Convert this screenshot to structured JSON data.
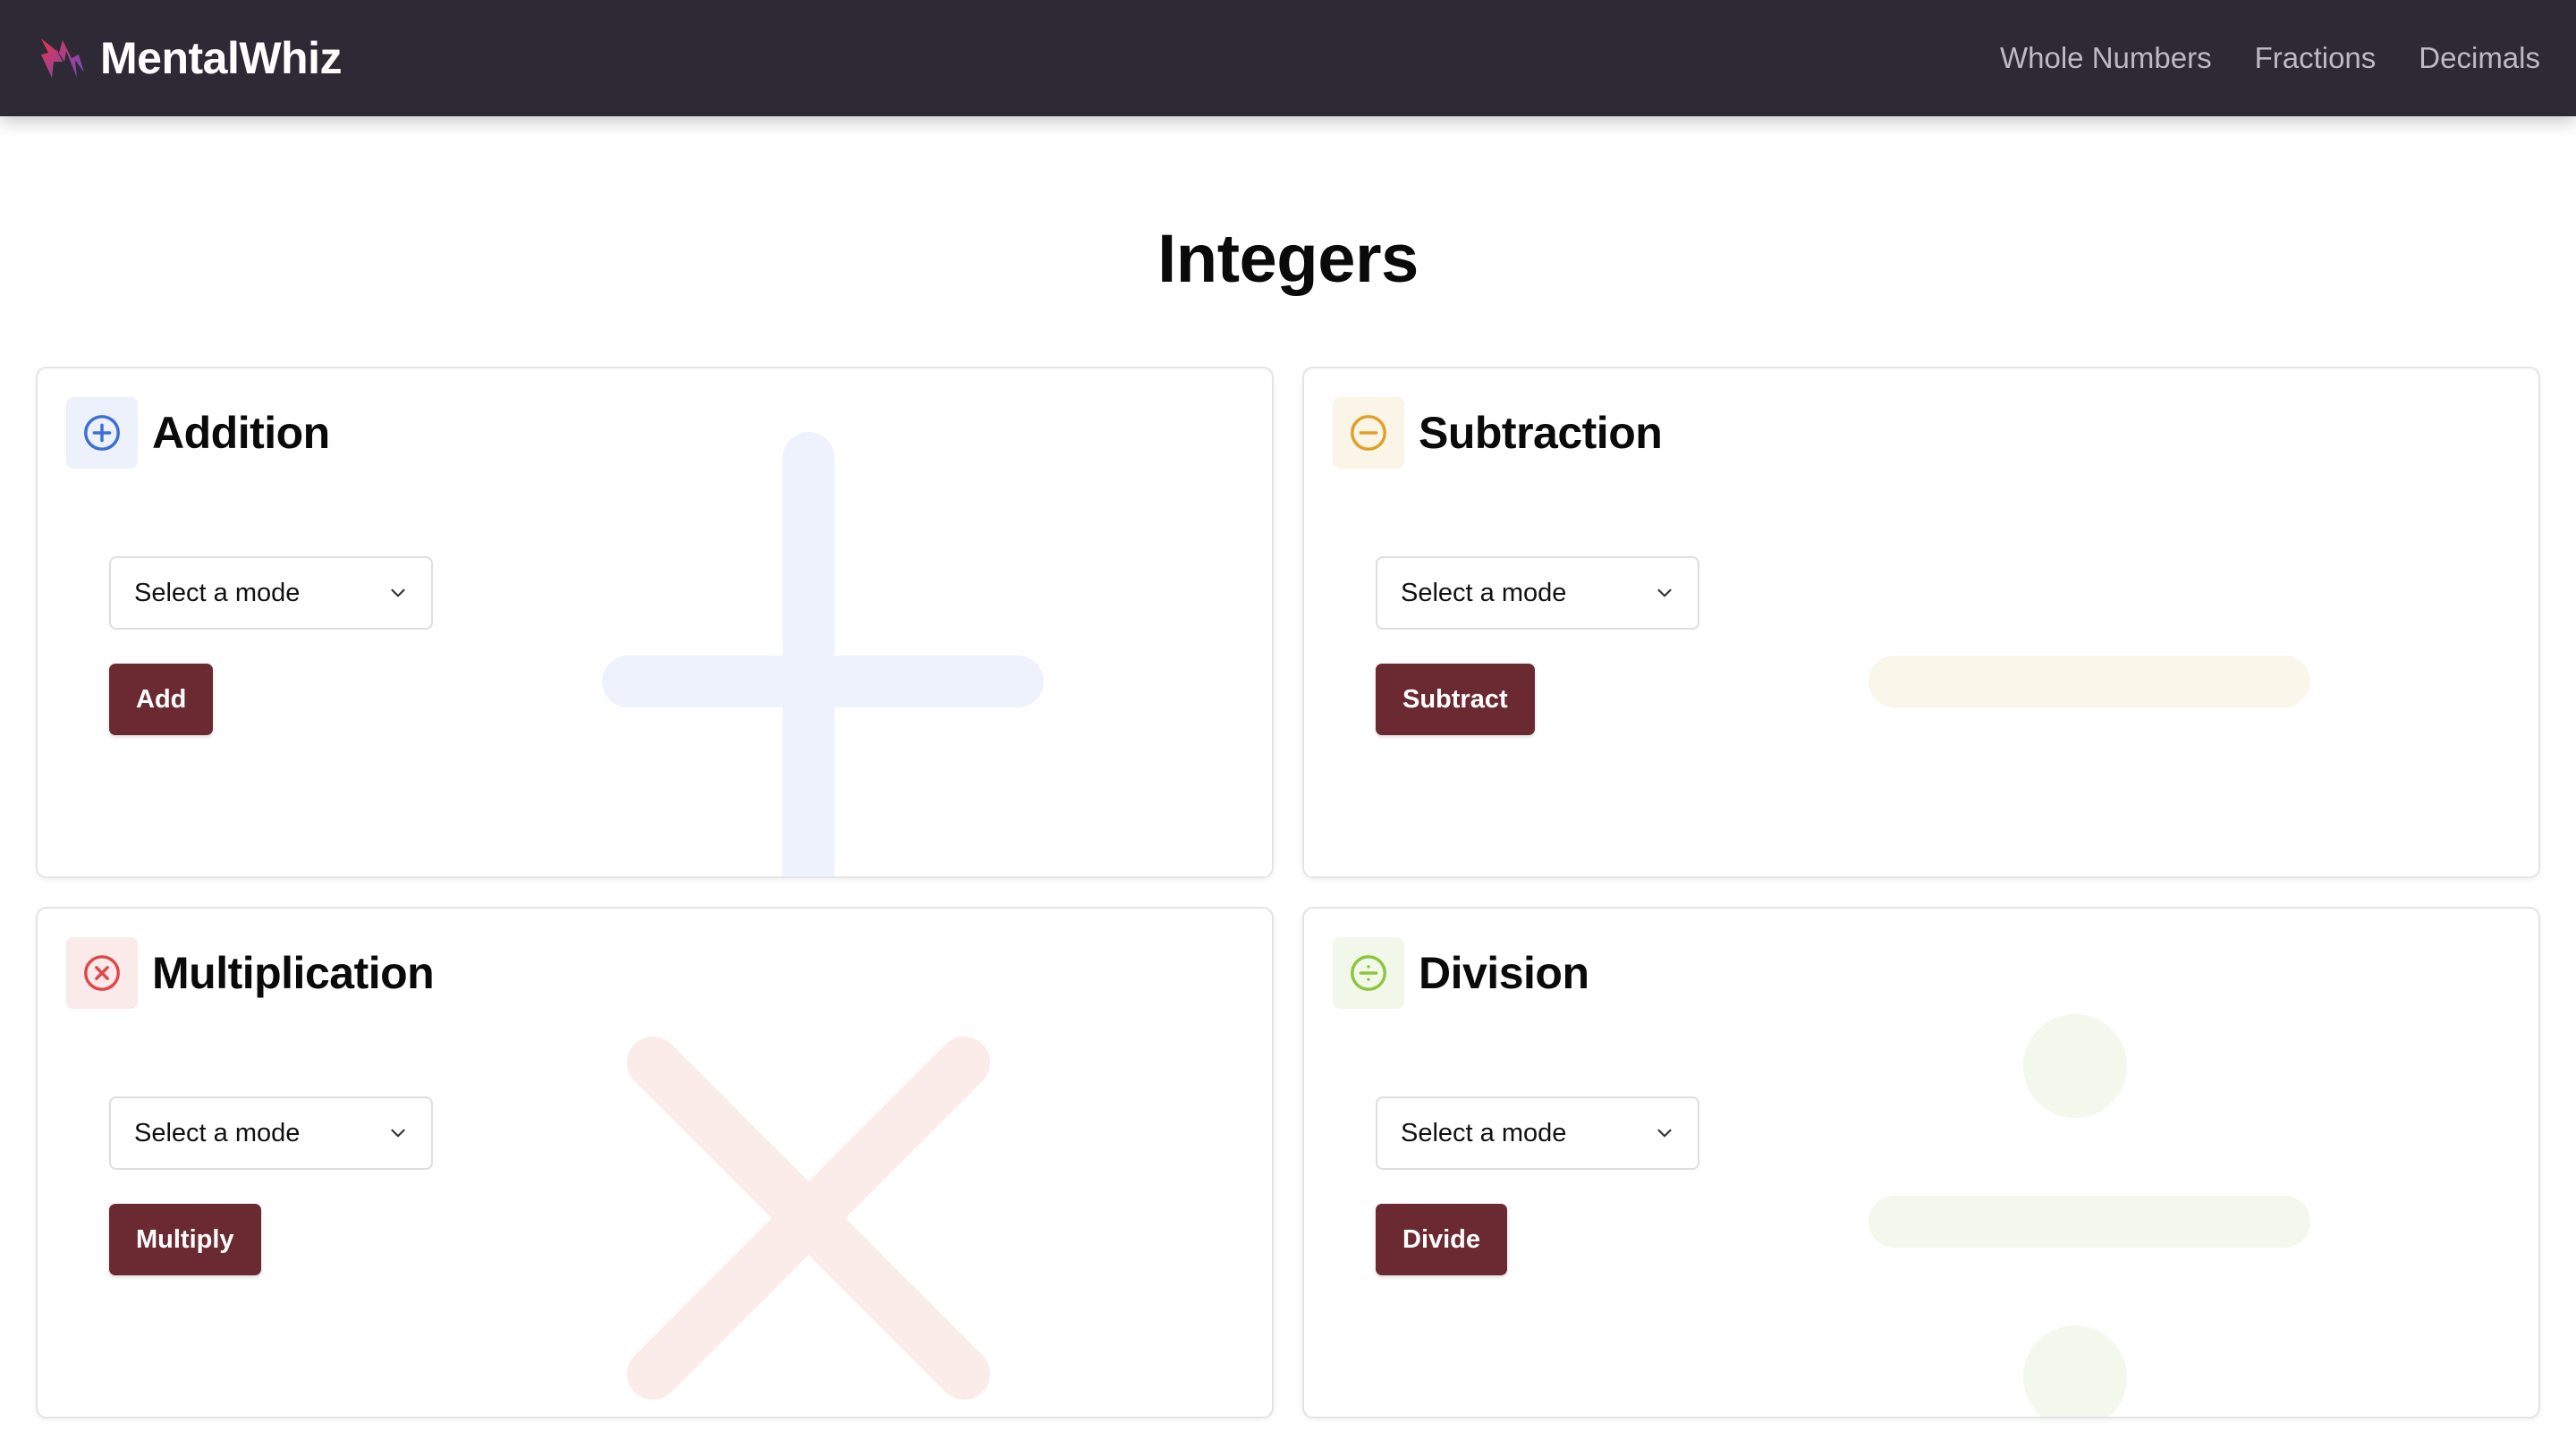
{
  "brand": {
    "name": "MentalWhiz",
    "logo_icon": "lightning-logo-icon"
  },
  "nav": {
    "links": [
      {
        "label": "Whole Numbers"
      },
      {
        "label": "Fractions"
      },
      {
        "label": "Decimals"
      }
    ]
  },
  "page": {
    "title": "Integers"
  },
  "cards": [
    {
      "id": "addition",
      "title": "Addition",
      "icon": "plus-circle-icon",
      "accent": "#3b6fd6",
      "icon_bg": "#edf1fb",
      "watermark": "plus",
      "watermark_color": "#eef2fc",
      "select_placeholder": "Select a mode",
      "button_label": "Add"
    },
    {
      "id": "subtraction",
      "title": "Subtraction",
      "icon": "minus-circle-icon",
      "accent": "#e0a024",
      "icon_bg": "#fbf5e8",
      "watermark": "minus",
      "watermark_color": "#fbf6ea",
      "select_placeholder": "Select a mode",
      "button_label": "Subtract"
    },
    {
      "id": "multiplication",
      "title": "Multiplication",
      "icon": "x-circle-icon",
      "accent": "#e04848",
      "icon_bg": "#fbeaea",
      "watermark": "times",
      "watermark_color": "#fbebe9",
      "select_placeholder": "Select a mode",
      "button_label": "Multiply"
    },
    {
      "id": "division",
      "title": "Division",
      "icon": "divide-circle-icon",
      "accent": "#8cc63f",
      "icon_bg": "#f2f8e9",
      "watermark": "divide",
      "watermark_color": "#f4f8ec",
      "select_placeholder": "Select a mode",
      "button_label": "Divide"
    }
  ],
  "colors": {
    "navbar_bg": "#2d2a35",
    "button_bg": "#6b2a31",
    "button_text": "#ffffff"
  }
}
